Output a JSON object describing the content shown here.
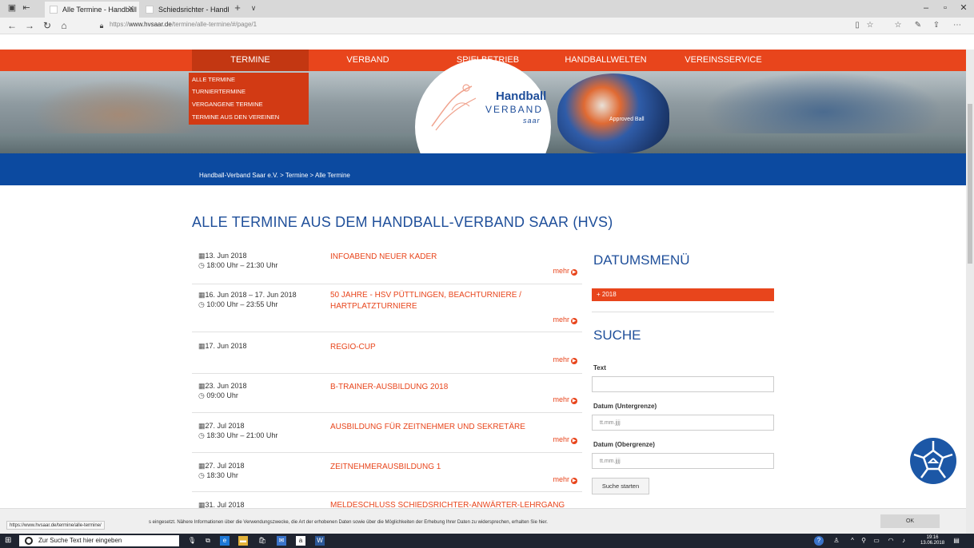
{
  "browser": {
    "tabs": [
      {
        "label": "Alle Termine - Handball"
      },
      {
        "label": "Schiedsrichter - Handball-V"
      }
    ],
    "new_tab": "+",
    "tab_menu": "∨",
    "url_prefix": "https://",
    "url_domain": "www.hvsaar.de",
    "url_path": "/termine/alle-termine/#/page/1",
    "status_url": "https://www.hvsaar.de/termine/alle-termine/"
  },
  "nav": {
    "items": [
      "TERMINE",
      "VERBAND",
      "SPIELBETRIEB",
      "HANDBALLWELTEN",
      "VEREINSSERVICE"
    ],
    "dropdown": [
      "ALLE TERMINE",
      "TURNIERTERMINE",
      "VERGANGENE TERMINE",
      "TERMINE AUS DEN VEREINEN"
    ]
  },
  "logo": {
    "line1": "Handball",
    "line2": "VERBAND",
    "line3": "saar",
    "ball_text": "Approved Ball"
  },
  "breadcrumb": "Handball-Verband Saar e.V. > Termine > Alle Termine",
  "page_title": "ALLE TERMINE AUS DEM HANDBALL-VERBAND SAAR (HVS)",
  "events": [
    {
      "date": "13. Jun 2018",
      "time": "18:00 Uhr – 21:30 Uhr",
      "title": "INFOABEND NEUER KADER",
      "more": "mehr"
    },
    {
      "date": "16. Jun 2018 – 17. Jun 2018",
      "time": "10:00 Uhr – 23:55 Uhr",
      "title": "50 JAHRE - HSV PÜTTLINGEN, BEACHTURNIERE /",
      "title2": "HARTPLATZTURNIERE",
      "more": "mehr"
    },
    {
      "date": "17. Jun 2018",
      "time": "",
      "title": "REGIO-CUP",
      "more": "mehr"
    },
    {
      "date": "23. Jun 2018",
      "time": "09:00 Uhr",
      "title": "B-TRAINER-AUSBILDUNG 2018",
      "more": "mehr"
    },
    {
      "date": "27. Jul 2018",
      "time": "18:30 Uhr – 21:00 Uhr",
      "title": "AUSBILDUNG FÜR ZEITNEHMER UND SEKRETÄRE",
      "more": "mehr"
    },
    {
      "date": "27. Jul 2018",
      "time": "18:30 Uhr",
      "title": "ZEITNEHMERAUSBILDUNG 1",
      "more": "mehr"
    },
    {
      "date": "31. Jul 2018",
      "time": "",
      "title": "MELDESCHLUSS SCHIEDSRICHTER-ANWÄRTER-LEHRGANG",
      "more": ""
    }
  ],
  "sidebar": {
    "date_menu_title": "DATUMSMENÜ",
    "year_button": "+ 2018",
    "search_title": "SUCHE",
    "text_label": "Text",
    "text_value": "",
    "date_lower_label": "Datum (Untergrenze)",
    "date_lower_placeholder": "tt.mm.jjjj",
    "date_upper_label": "Datum (Obergrenze)",
    "date_upper_placeholder": "tt.mm.jjjj",
    "search_button": "Suche starten"
  },
  "cookie": {
    "text": "s eingesetzt. Nähere Informationen über die Verwendungszwecke, die Art der erhobenen Daten sowie über die Möglichkeiten der Erhebung Ihrer Daten zu widersprechen, erhalten Sie hier.",
    "ok": "OK"
  },
  "taskbar": {
    "search_placeholder": "Zur Suche Text hier eingeben",
    "time": "19:16",
    "date": "13.06.2018"
  },
  "colors": {
    "brand_orange": "#e8451c",
    "brand_blue": "#0c4aa0",
    "title_blue": "#1f4f9a"
  }
}
